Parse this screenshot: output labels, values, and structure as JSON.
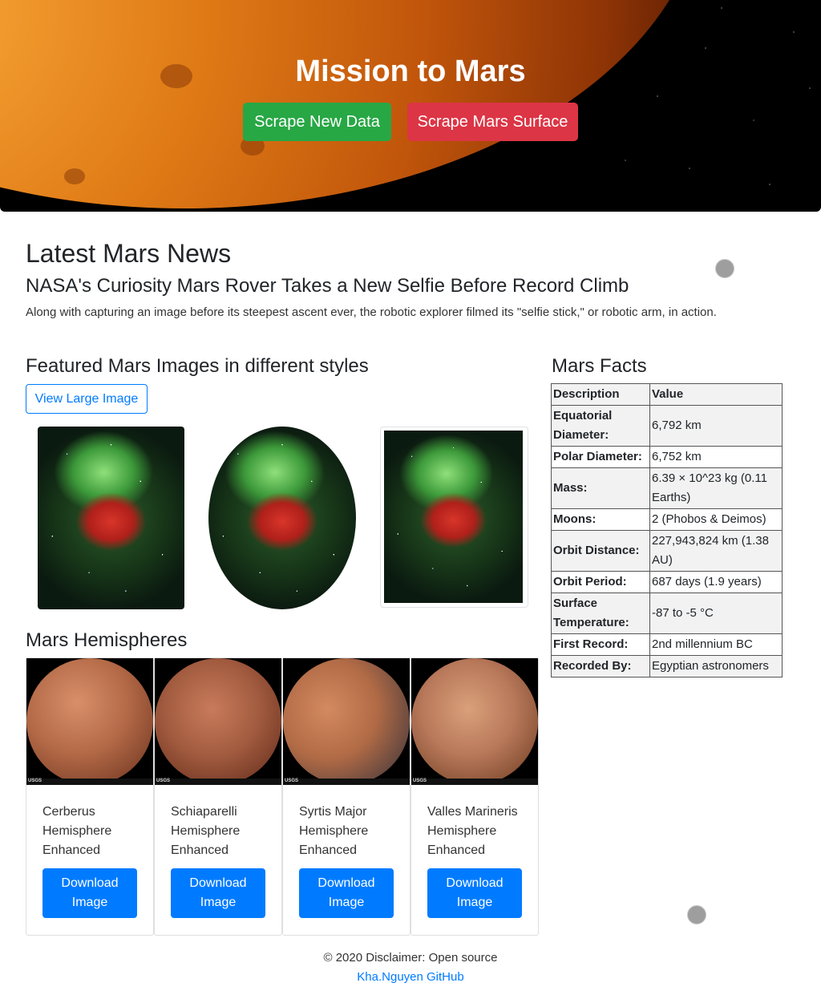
{
  "header": {
    "title": "Mission to Mars",
    "scrape_button": "Scrape New Data",
    "surface_button": "Scrape Mars Surface"
  },
  "news": {
    "heading": "Latest Mars News",
    "title": "NASA's Curiosity Mars Rover Takes a New Selfie Before Record Climb",
    "paragraph": "Along with capturing an image before its steepest ascent ever, the robotic explorer filmed its \"selfie stick,\" or robotic arm, in action."
  },
  "featured": {
    "heading": "Featured Mars Images in different styles",
    "view_button": "View Large Image"
  },
  "hemispheres": {
    "heading": "Mars Hemispheres",
    "download_label": "Download Image",
    "items": [
      {
        "title": "Cerberus Hemisphere Enhanced"
      },
      {
        "title": "Schiaparelli Hemisphere Enhanced"
      },
      {
        "title": "Syrtis Major Hemisphere Enhanced"
      },
      {
        "title": "Valles Marineris Hemisphere Enhanced"
      }
    ],
    "usgs_label": "USGS"
  },
  "facts": {
    "heading": "Mars Facts",
    "columns": [
      "Description",
      "Value"
    ],
    "rows": [
      [
        "Equatorial Diameter:",
        "6,792 km"
      ],
      [
        "Polar Diameter:",
        "6,752 km"
      ],
      [
        "Mass:",
        "6.39 × 10^23 kg (0.11 Earths)"
      ],
      [
        "Moons:",
        "2 (Phobos & Deimos)"
      ],
      [
        "Orbit Distance:",
        "227,943,824 km (1.38 AU)"
      ],
      [
        "Orbit Period:",
        "687 days (1.9 years)"
      ],
      [
        "Surface Temperature:",
        "-87 to -5 °C"
      ],
      [
        "First Record:",
        "2nd millennium BC"
      ],
      [
        "Recorded By:",
        "Egyptian astronomers"
      ]
    ]
  },
  "footer": {
    "disclaimer": "© 2020 Disclaimer: Open source",
    "link": "Kha.Nguyen GitHub"
  },
  "colors": {
    "green": "#28a745",
    "red": "#dc3545",
    "blue": "#007bff"
  }
}
